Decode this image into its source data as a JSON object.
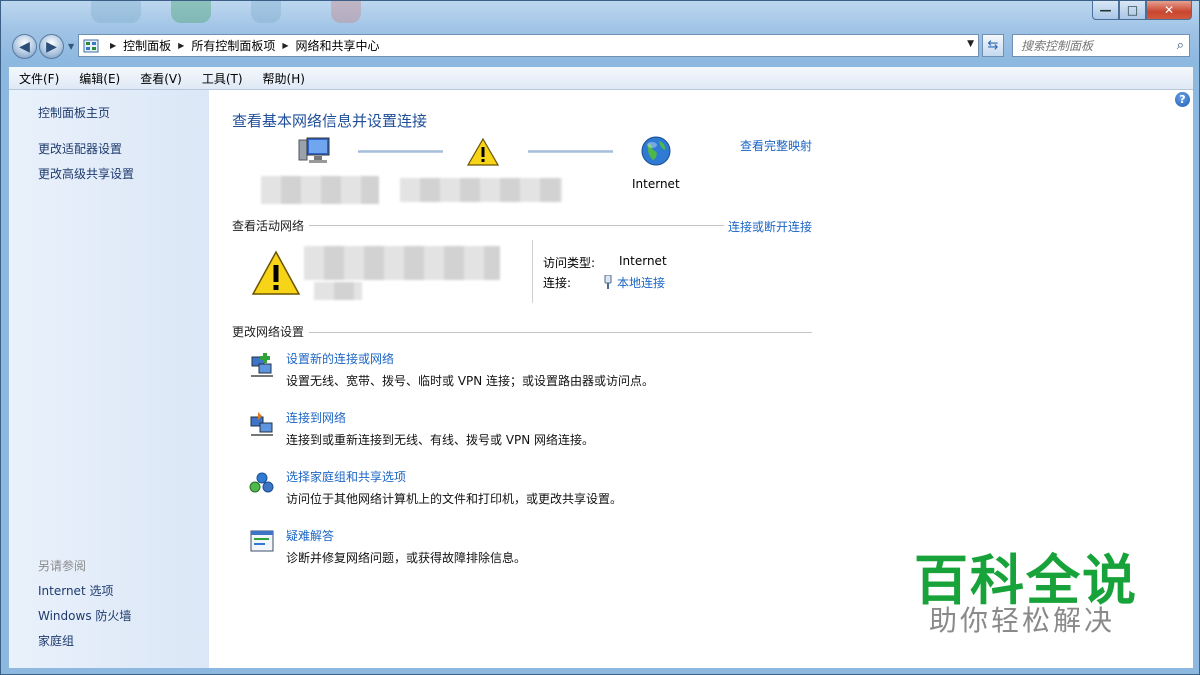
{
  "window": {
    "min_label": "—",
    "max_label": "□",
    "close_label": "✕"
  },
  "breadcrumb": [
    "控制面板",
    "所有控制面板项",
    "网络和共享中心"
  ],
  "search": {
    "placeholder": "搜索控制面板"
  },
  "menu": [
    "文件(F)",
    "编辑(E)",
    "查看(V)",
    "工具(T)",
    "帮助(H)"
  ],
  "sidebar": {
    "home": "控制面板主页",
    "links": [
      "更改适配器设置",
      "更改高级共享设置"
    ],
    "see_also_title": "另请参阅",
    "see_also": [
      "Internet 选项",
      "Windows 防火墙",
      "家庭组"
    ]
  },
  "main": {
    "heading": "查看基本网络信息并设置连接",
    "map_link": "查看完整映射",
    "internet_label": "Internet",
    "active_title": "查看活动网络",
    "connect_link": "连接或断开连接",
    "access_type_label": "访问类型:",
    "access_type_value": "Internet",
    "connection_label": "连接:",
    "connection_value": "本地连接",
    "change_title": "更改网络设置",
    "tasks": [
      {
        "icon": "new-connection-icon",
        "title": "设置新的连接或网络",
        "desc": "设置无线、宽带、拨号、临时或 VPN 连接；或设置路由器或访问点。"
      },
      {
        "icon": "connect-network-icon",
        "title": "连接到网络",
        "desc": "连接到或重新连接到无线、有线、拨号或 VPN 网络连接。"
      },
      {
        "icon": "homegroup-icon",
        "title": "选择家庭组和共享选项",
        "desc": "访问位于其他网络计算机上的文件和打印机，或更改共享设置。"
      },
      {
        "icon": "troubleshoot-icon",
        "title": "疑难解答",
        "desc": "诊断并修复网络问题，或获得故障排除信息。"
      }
    ]
  },
  "watermark": {
    "title": "百科全说",
    "subtitle": "助你轻松解决"
  },
  "colors": {
    "link": "#1c66c5",
    "heading": "#1f4f9a",
    "watermark_green": "#18a33a"
  }
}
